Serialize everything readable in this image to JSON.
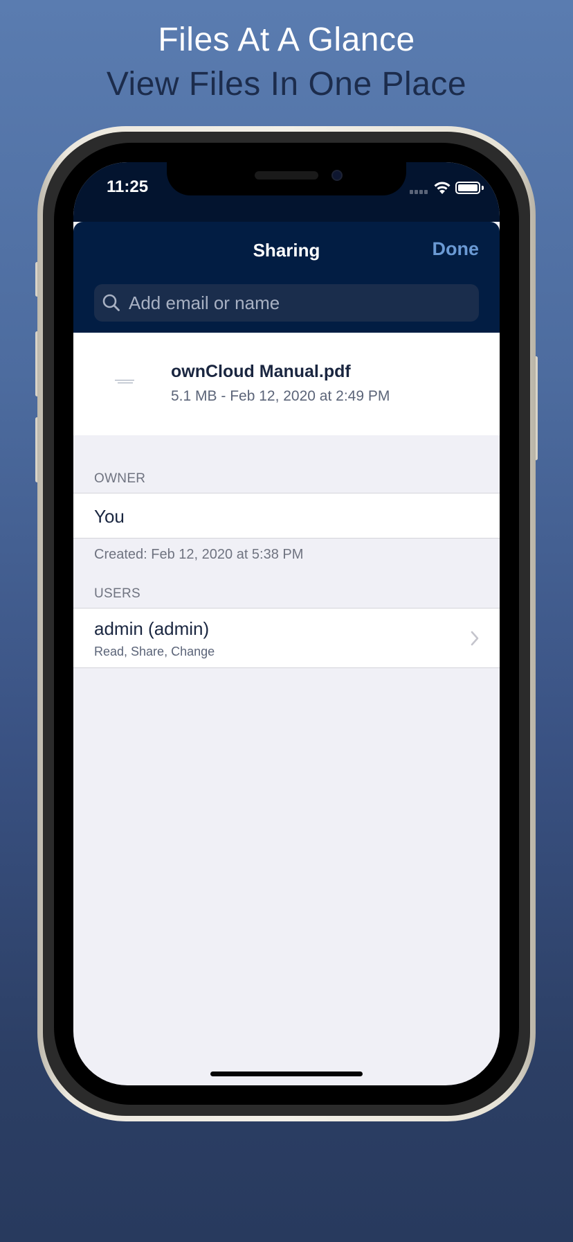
{
  "promo": {
    "headline": "Files At A Glance",
    "subline": "View Files In One Place"
  },
  "status_bar": {
    "time": "11:25",
    "icons": [
      "cellular-signal-icon",
      "wifi-icon",
      "battery-icon"
    ]
  },
  "sheet": {
    "title": "Sharing",
    "done_label": "Done"
  },
  "search": {
    "placeholder": "Add email or name",
    "icon": "search-icon"
  },
  "file": {
    "name": "ownCloud Manual.pdf",
    "meta": "5.1 MB - Feb 12, 2020 at 2:49 PM"
  },
  "owner_section": {
    "header": "OWNER",
    "owner": "You",
    "footer": "Created: Feb 12, 2020 at 5:38 PM"
  },
  "users_section": {
    "header": "USERS",
    "users": [
      {
        "name": "admin (admin)",
        "permissions": "Read, Share, Change"
      }
    ]
  },
  "colors": {
    "nav_background": "#021d43",
    "accent": "#6b9ad4",
    "list_background": "#f0f0f6"
  }
}
